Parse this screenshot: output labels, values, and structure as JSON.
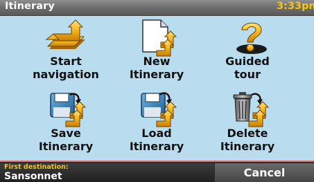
{
  "header": {
    "title": "Itinerary",
    "time": "3:33pm"
  },
  "menu": {
    "items": [
      {
        "label": "Start\nnavigation",
        "icon": "start-navigation-icon"
      },
      {
        "label": "New\nItinerary",
        "icon": "new-document-icon"
      },
      {
        "label": "Guided\ntour",
        "icon": "question-mark-icon"
      },
      {
        "label": "Save\nItinerary",
        "icon": "save-disk-icon"
      },
      {
        "label": "Load\nItinerary",
        "icon": "load-disk-icon"
      },
      {
        "label": "Delete\nItinerary",
        "icon": "trash-can-icon"
      }
    ]
  },
  "footer": {
    "destination_caption": "First destination:",
    "destination_value": "Sansonnet",
    "cancel_label": "Cancel"
  },
  "colors": {
    "panel_background": "#b9dcee",
    "accent_yellow": "#f5c417",
    "title_bar": "#6f6f6f",
    "footer": "#2b2b2b"
  }
}
